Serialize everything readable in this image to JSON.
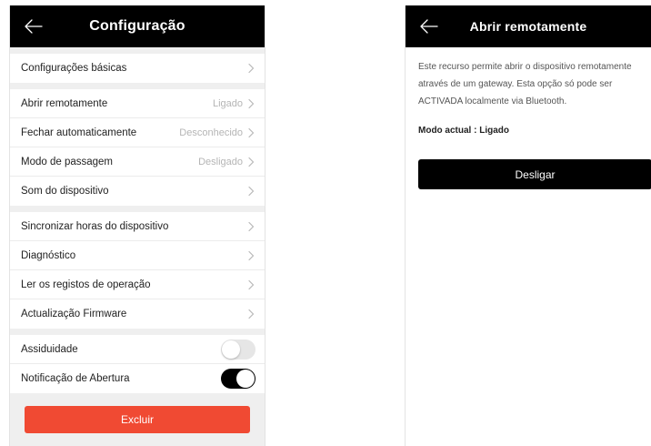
{
  "settings_screen": {
    "title": "Configuração",
    "groups": [
      [
        {
          "label": "Configurações básicas",
          "value": ""
        }
      ],
      [
        {
          "label": "Abrir remotamente",
          "value": "Ligado"
        },
        {
          "label": "Fechar automaticamente",
          "value": "Desconhecido"
        },
        {
          "label": "Modo de passagem",
          "value": "Desligado"
        },
        {
          "label": "Som do dispositivo",
          "value": ""
        }
      ],
      [
        {
          "label": "Sincronizar horas do dispositivo",
          "value": ""
        },
        {
          "label": "Diagnóstico",
          "value": ""
        },
        {
          "label": "Ler os registos de operação",
          "value": ""
        },
        {
          "label": "Actualização Firmware",
          "value": ""
        }
      ]
    ],
    "toggles": [
      {
        "label": "Assiduidade",
        "state": "off"
      },
      {
        "label": "Notificação de Abertura",
        "state": "on"
      }
    ],
    "delete_button": "Excluir",
    "delete_color": "#f04a33"
  },
  "remote_screen": {
    "title": "Abrir remotamente",
    "description": "Este recurso permite abrir o dispositivo remotamente através de um gateway. Esta opção só pode ser ACTIVADA localmente via Bluetooth.",
    "mode": "Modo actual : Ligado",
    "button": "Desligar"
  },
  "icons": {
    "back": "arrow-left-icon",
    "chevron": "chevron-right-icon"
  }
}
